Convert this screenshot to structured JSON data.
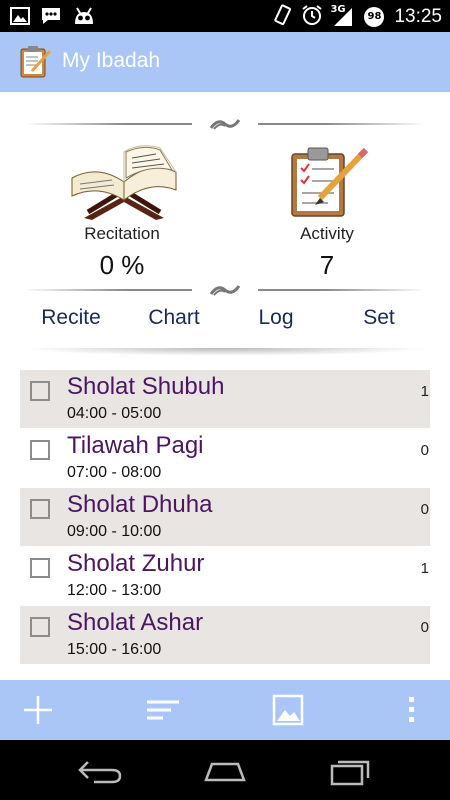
{
  "status_bar": {
    "time": "13:25",
    "network": "3G",
    "battery": "98",
    "icons": [
      "image-icon",
      "chat-icon",
      "android-icon",
      "rotate-icon",
      "alarm-icon",
      "signal-icon",
      "battery-icon"
    ]
  },
  "app": {
    "title": "My Ibadah",
    "accent": "#a9c6f7",
    "item_title_color": "#4a1660"
  },
  "stats": {
    "recitation_label": "Recitation",
    "recitation_value": "0 %",
    "activity_label": "Activity",
    "activity_value": "7"
  },
  "nav": {
    "recite": "Recite",
    "chart": "Chart",
    "log": "Log",
    "set": "Set"
  },
  "items": [
    {
      "title": "Sholat Shubuh",
      "time": "04:00 - 05:00",
      "count": "1",
      "checked": false
    },
    {
      "title": "Tilawah Pagi",
      "time": "07:00 - 08:00",
      "count": "0",
      "checked": false
    },
    {
      "title": "Sholat Dhuha",
      "time": "09:00 - 10:00",
      "count": "0",
      "checked": false
    },
    {
      "title": "Sholat Zuhur",
      "time": "12:00 - 13:00",
      "count": "1",
      "checked": false
    },
    {
      "title": "Sholat Ashar",
      "time": "15:00 - 16:00",
      "count": "0",
      "checked": false
    }
  ],
  "toolbar": {
    "icons": [
      "add-icon",
      "sort-icon",
      "image-icon",
      "overflow-menu-icon"
    ]
  },
  "system_nav": {
    "icons": [
      "back-icon",
      "home-icon",
      "recents-icon"
    ]
  }
}
